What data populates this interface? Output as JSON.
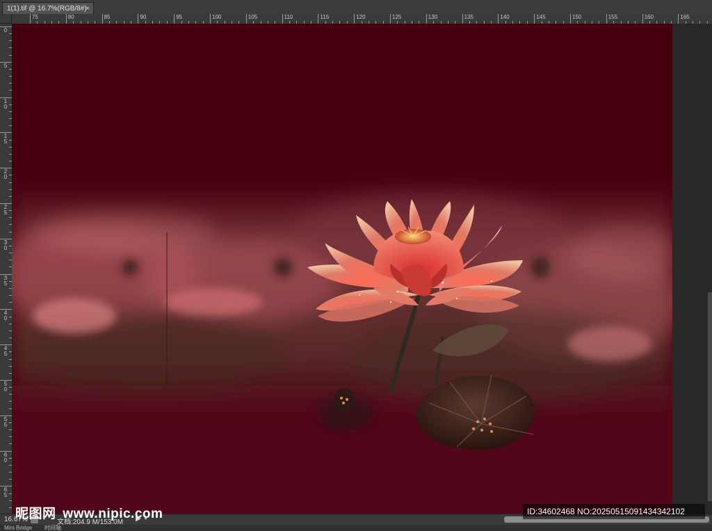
{
  "document_tab": {
    "title": "1(1).tif @ 16.7%(RGB/8#)",
    "close_glyph": "×"
  },
  "ruler": {
    "horizontal": [
      "75",
      "80",
      "85",
      "90",
      "95",
      "100",
      "105",
      "110",
      "115",
      "120",
      "125",
      "130",
      "135",
      "140",
      "145",
      "150",
      "155",
      "160",
      "165"
    ],
    "vertical": [
      [
        "0"
      ],
      [
        "5"
      ],
      [
        "1",
        "0"
      ],
      [
        "1",
        "5"
      ],
      [
        "2",
        "0"
      ],
      [
        "2",
        "5"
      ],
      [
        "3",
        "0"
      ],
      [
        "3",
        "5"
      ],
      [
        "4",
        "0"
      ],
      [
        "4",
        "5"
      ],
      [
        "5",
        "0"
      ],
      [
        "5",
        "5"
      ],
      [
        "6",
        "0"
      ],
      [
        "6",
        "5"
      ]
    ]
  },
  "canvas": {
    "background_color": "#4a0016",
    "subject": "lotus-artwork"
  },
  "status_bar": {
    "zoom": "16.67%",
    "doc_info": "文档:204.9 M/153.0M",
    "menu_arrow": "▶",
    "scroll_left_arrow": "◂"
  },
  "bottom_tabs": [
    "Mini Bridge",
    "时间轴"
  ],
  "watermark": {
    "site_name": "昵图网",
    "site_url": "www.nipic.com",
    "image_id": "ID:34602468 NO:20250515091434342102"
  }
}
